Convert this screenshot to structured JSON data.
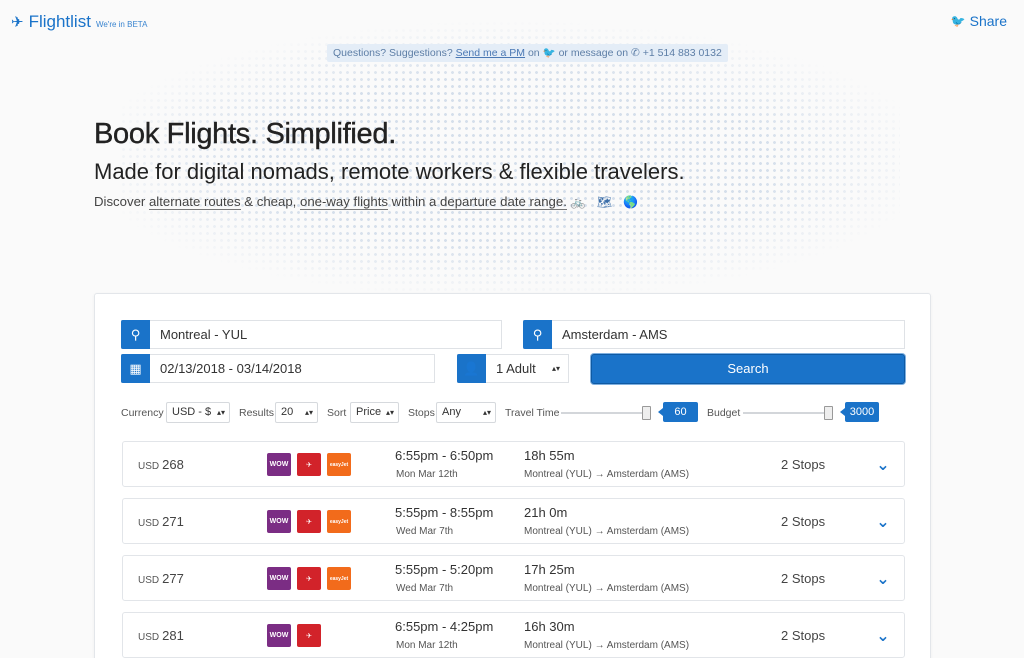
{
  "brand": {
    "name": "Flightlist",
    "beta": "We're in BETA",
    "icon": "plane-icon"
  },
  "share_label": "Share",
  "feedback": {
    "prefix": "Questions? Suggestions?",
    "link": "Send me a PM",
    "mid": "on",
    "mid2": "or message on",
    "phone": "+1 514 883 0132"
  },
  "hero": {
    "title": "Book Flights. Simplified.",
    "subtitle": "Made for digital nomads, remote workers & flexible travelers.",
    "desc_1": "Discover",
    "alt_routes": "alternate routes",
    "desc_2": "& cheap,",
    "one_way": "one-way flights",
    "desc_3": "within a",
    "date_range": "departure date range.",
    "emoji": "🚲 🗺 🌎"
  },
  "search": {
    "origin": "Montreal - YUL",
    "destination": "Amsterdam - AMS",
    "dates": "02/13/2018 - 03/14/2018",
    "passengers": "1 Adult",
    "button": "Search"
  },
  "filters": {
    "currency_label": "Currency",
    "currency_value": "USD - $",
    "results_label": "Results",
    "results_value": "20",
    "sort_label": "Sort",
    "sort_value": "Price",
    "stops_label": "Stops",
    "stops_value": "Any",
    "travel_time_label": "Travel Time",
    "travel_time_value": "60",
    "budget_label": "Budget",
    "budget_value": "3000"
  },
  "results": [
    {
      "currency": "USD",
      "price": "268",
      "airlines": [
        "wow",
        "norwegian",
        "easyjet"
      ],
      "times": "6:55pm - 6:50pm",
      "date": "Mon Mar 12th",
      "duration": "18h 55m",
      "route": "Montreal (YUL) → Amsterdam (AMS)",
      "stops": "2 Stops"
    },
    {
      "currency": "USD",
      "price": "271",
      "airlines": [
        "wow",
        "norwegian",
        "easyjet"
      ],
      "times": "5:55pm - 8:55pm",
      "date": "Wed Mar 7th",
      "duration": "21h 0m",
      "route": "Montreal (YUL) → Amsterdam (AMS)",
      "stops": "2 Stops"
    },
    {
      "currency": "USD",
      "price": "277",
      "airlines": [
        "wow",
        "norwegian",
        "easyjet"
      ],
      "times": "5:55pm - 5:20pm",
      "date": "Wed Mar 7th",
      "duration": "17h 25m",
      "route": "Montreal (YUL) → Amsterdam (AMS)",
      "stops": "2 Stops"
    },
    {
      "currency": "USD",
      "price": "281",
      "airlines": [
        "wow",
        "norwegian"
      ],
      "times": "6:55pm - 4:25pm",
      "date": "Mon Mar 12th",
      "duration": "16h 30m",
      "route": "Montreal (YUL) → Amsterdam (AMS)",
      "stops": "2 Stops"
    }
  ],
  "logo_text": {
    "wow": "WOW",
    "norwegian": "✈",
    "easyjet": "easyJet"
  },
  "colors": {
    "accent": "#1a73c9",
    "wow": "#7b2d84",
    "norwegian": "#d2232a",
    "easyjet": "#f26b1b"
  }
}
